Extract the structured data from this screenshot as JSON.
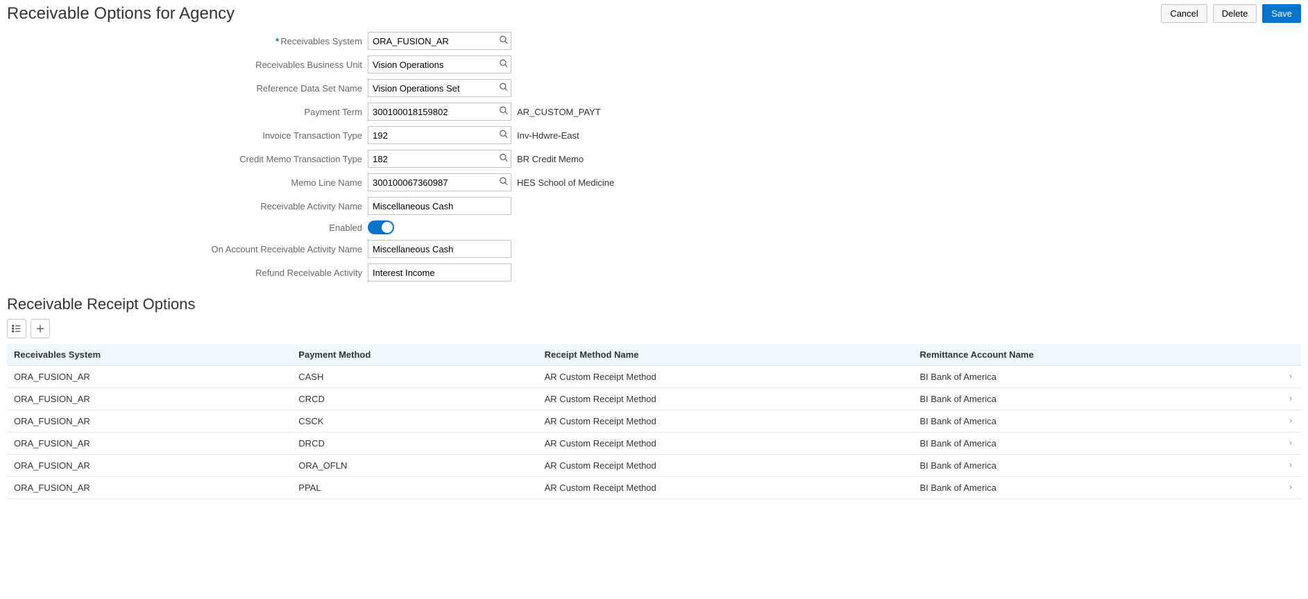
{
  "header": {
    "title": "Receivable Options for Agency",
    "buttons": {
      "cancel": "Cancel",
      "delete": "Delete",
      "save": "Save"
    }
  },
  "form": {
    "receivables_system": {
      "label": "Receivables System",
      "value": "ORA_FUSION_AR",
      "required": true
    },
    "business_unit": {
      "label": "Receivables Business Unit",
      "value": "Vision Operations"
    },
    "ref_data_set": {
      "label": "Reference Data Set Name",
      "value": "Vision Operations Set"
    },
    "payment_term": {
      "label": "Payment Term",
      "value": "300100018159802",
      "hint": "AR_CUSTOM_PAYT"
    },
    "invoice_txn_type": {
      "label": "Invoice Transaction Type",
      "value": "192",
      "hint": "Inv-Hdwre-East"
    },
    "credit_memo_txn_type": {
      "label": "Credit Memo Transaction Type",
      "value": "182",
      "hint": "BR Credit Memo"
    },
    "memo_line_name": {
      "label": "Memo Line Name",
      "value": "300100067360987",
      "hint": "HES School of Medicine"
    },
    "activity_name": {
      "label": "Receivable Activity Name",
      "value": "Miscellaneous Cash"
    },
    "enabled": {
      "label": "Enabled",
      "value": true
    },
    "on_account_activity": {
      "label": "On Account Receivable Activity Name",
      "value": "Miscellaneous Cash"
    },
    "refund_activity": {
      "label": "Refund Receivable Activity",
      "value": "Interest Income"
    }
  },
  "receipt_options": {
    "title": "Receivable Receipt Options",
    "columns": {
      "system": "Receivables System",
      "method": "Payment Method",
      "receipt_name": "Receipt Method Name",
      "remit": "Remittance Account Name"
    },
    "rows": [
      {
        "system": "ORA_FUSION_AR",
        "method": "CASH",
        "receipt_name": "AR Custom Receipt Method",
        "remit": "BI Bank of America"
      },
      {
        "system": "ORA_FUSION_AR",
        "method": "CRCD",
        "receipt_name": "AR Custom Receipt Method",
        "remit": "BI Bank of America"
      },
      {
        "system": "ORA_FUSION_AR",
        "method": "CSCK",
        "receipt_name": "AR Custom Receipt Method",
        "remit": "BI Bank of America"
      },
      {
        "system": "ORA_FUSION_AR",
        "method": "DRCD",
        "receipt_name": "AR Custom Receipt Method",
        "remit": "BI Bank of America"
      },
      {
        "system": "ORA_FUSION_AR",
        "method": "ORA_OFLN",
        "receipt_name": "AR Custom Receipt Method",
        "remit": "BI Bank of America"
      },
      {
        "system": "ORA_FUSION_AR",
        "method": "PPAL",
        "receipt_name": "AR Custom Receipt Method",
        "remit": "BI Bank of America"
      }
    ]
  }
}
